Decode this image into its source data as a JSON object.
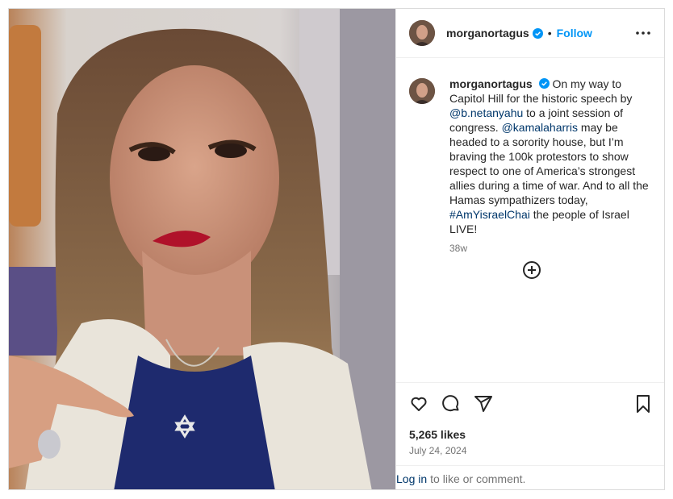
{
  "post": {
    "username": "morganortagus",
    "follow_label": "Follow",
    "separator": "•",
    "caption": {
      "t1": "On my way to Capitol Hill for the historic speech by",
      "m1": "@b.netanyahu",
      "t2": "to a joint session of congress.",
      "m2": "@kamalaharris",
      "t3": "may be headed to a sorority house, but I’m braving the 100k protestors to show respect to one of America’s strongest allies during a time of war. And to all the Hamas sympathizers today,",
      "h1": "#AmYisraelChai",
      "t4": "the people of Israel LIVE!"
    },
    "age": "38w",
    "likes": "5,265 likes",
    "date": "July 24, 2024",
    "login_label": "Log in",
    "login_suffix": "to like or comment."
  },
  "colors": {
    "follow": "#0095f6",
    "link": "#00376b",
    "verified": "#0095f6",
    "muted": "#737373"
  },
  "icons": [
    "heart-icon",
    "comment-icon",
    "share-icon",
    "bookmark-icon",
    "more-icon",
    "add-comment-icon",
    "verified-icon"
  ]
}
